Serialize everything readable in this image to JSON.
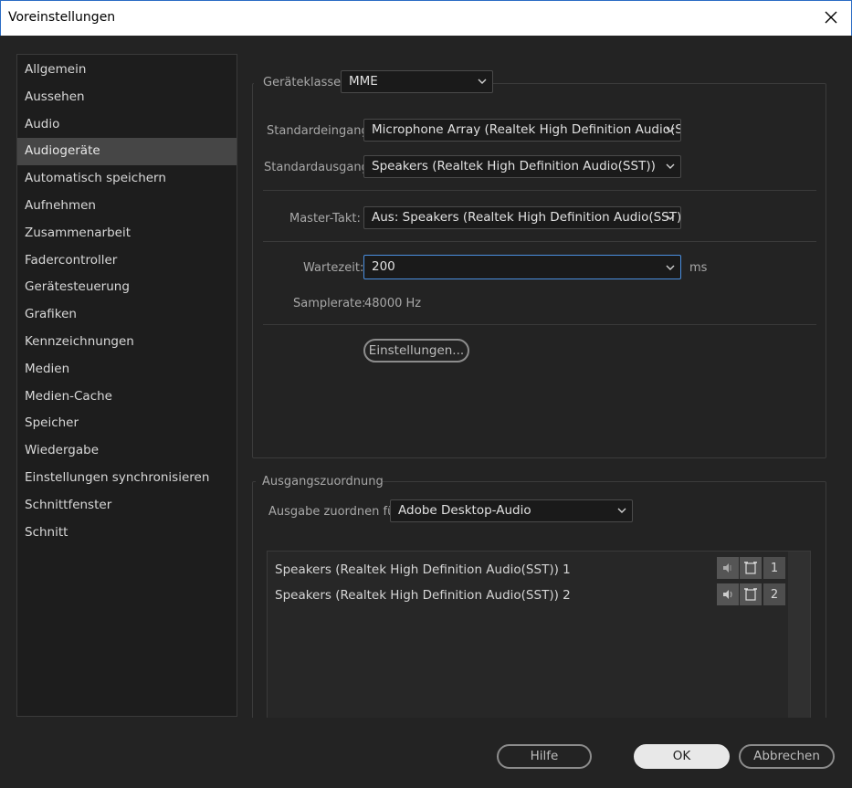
{
  "window": {
    "title": "Voreinstellungen",
    "close_icon": "close-icon"
  },
  "sidebar": {
    "active_index": 3,
    "items": [
      {
        "label": "Allgemein"
      },
      {
        "label": "Aussehen"
      },
      {
        "label": "Audio"
      },
      {
        "label": "Audiogeräte"
      },
      {
        "label": "Automatisch speichern"
      },
      {
        "label": "Aufnehmen"
      },
      {
        "label": "Zusammenarbeit"
      },
      {
        "label": "Fadercontroller"
      },
      {
        "label": "Gerätesteuerung"
      },
      {
        "label": "Grafiken"
      },
      {
        "label": "Kennzeichnungen"
      },
      {
        "label": "Medien"
      },
      {
        "label": "Medien-Cache"
      },
      {
        "label": "Speicher"
      },
      {
        "label": "Wiedergabe"
      },
      {
        "label": "Einstellungen synchronisieren"
      },
      {
        "label": "Schnittfenster"
      },
      {
        "label": "Schnitt"
      }
    ]
  },
  "device": {
    "class_label": "Geräteklasse:",
    "class_value": "MME",
    "input_label": "Standardeingang:",
    "input_value": "Microphone Array (Realtek High Definition Audio(SST))",
    "output_label": "Standardausgang:",
    "output_value": "Speakers (Realtek High Definition Audio(SST))",
    "master_label": "Master-Takt:",
    "master_value": "Aus: Speakers (Realtek High Definition Audio(SST))",
    "latency_label": "Wartezeit:",
    "latency_value": "200",
    "latency_unit": "ms",
    "samplerate_label": "Samplerate:",
    "samplerate_value": "48000 Hz",
    "settings_button": "Einstellungen..."
  },
  "output_mapping": {
    "group_title": "Ausgangszuordnung",
    "map_for_label": "Ausgabe zuordnen für:",
    "map_for_value": "Adobe Desktop-Audio",
    "rows": [
      {
        "label": "Speakers (Realtek High Definition Audio(SST)) 1",
        "channel": "1",
        "icon": "speaker-left-icon"
      },
      {
        "label": "Speakers (Realtek High Definition Audio(SST)) 2",
        "channel": "2",
        "icon": "speaker-right-icon"
      }
    ]
  },
  "footer": {
    "help": "Hilfe",
    "ok": "OK",
    "cancel": "Abbrechen"
  }
}
